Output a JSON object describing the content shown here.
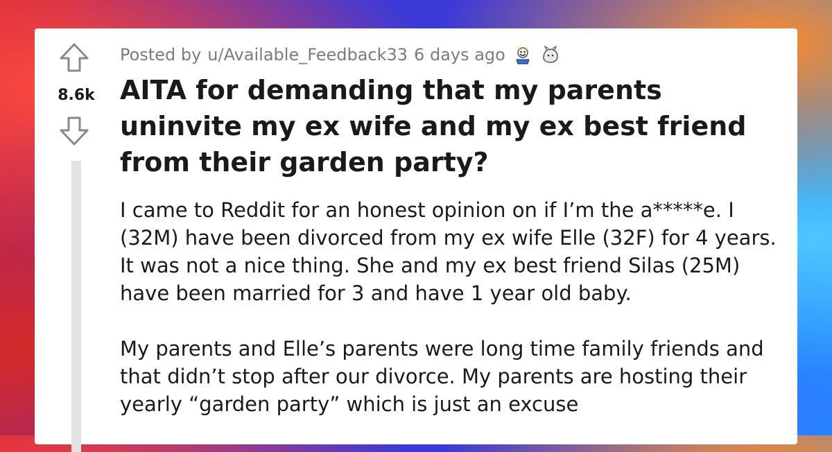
{
  "post": {
    "score": "8.6k",
    "meta": {
      "posted_by_prefix": "Posted by",
      "author": "u/Available_Feedback33",
      "age": "6 days ago"
    },
    "awards": [
      "wholesome-award-icon",
      "helpful-award-icon"
    ],
    "title": "AITA for demanding that my parents uninvite my ex wife and my ex best friend from their garden party?",
    "body": [
      "I came to Reddit for an honest opinion on if I’m the a*****e. I (32M) have been divorced from my ex wife Elle (32F) for 4 years. It was not a nice thing. She and my ex best friend Silas (25M) have been married for 3 and have 1 year old baby.",
      "My parents and Elle’s parents were long time family friends and that didn’t stop after our divorce. My parents are hosting their yearly “garden party” which is just an excuse"
    ]
  },
  "colors": {
    "card_bg": "#ffffff",
    "meta_text": "#787c7e",
    "primary_text": "#1a1a1b",
    "arrow_stroke": "#878a8c",
    "thread_line": "#e3e3e3"
  }
}
